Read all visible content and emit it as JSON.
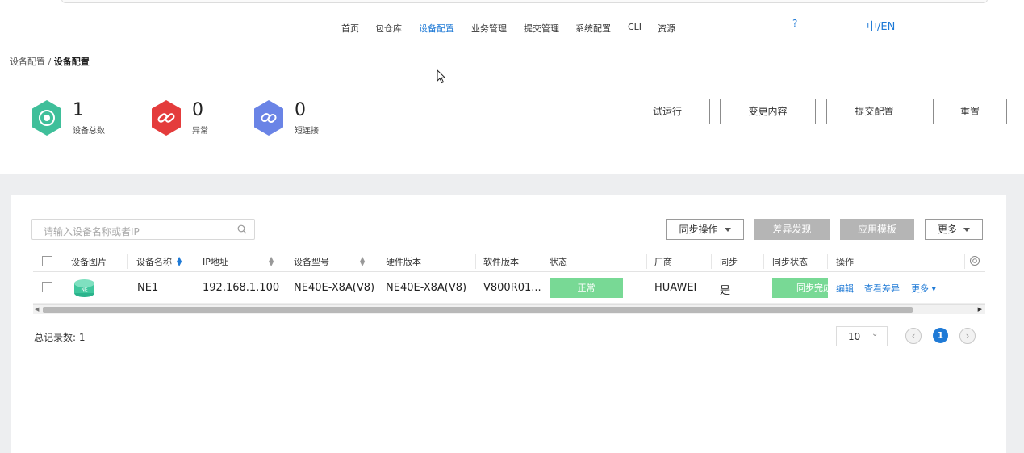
{
  "nav": {
    "items": [
      "首页",
      "包仓库",
      "设备配置",
      "业务管理",
      "提交管理",
      "系统配置",
      "CLI",
      "资源"
    ],
    "active_index": 2,
    "help": "?",
    "lang": "中/EN"
  },
  "breadcrumb": {
    "parent": "设备配置 / ",
    "current": "设备配置"
  },
  "stats": [
    {
      "value": "1",
      "label": "设备总数",
      "color": "#3fbf9a",
      "icon": "device-icon"
    },
    {
      "value": "0",
      "label": "异常",
      "color": "#e43c3c",
      "icon": "broken-link-icon"
    },
    {
      "value": "0",
      "label": "短连接",
      "color": "#6a84e6",
      "icon": "link-icon"
    }
  ],
  "actions": {
    "trial_run": "试运行",
    "change_content": "变更内容",
    "submit_config": "提交配置",
    "reset": "重置"
  },
  "toolbar": {
    "search_placeholder": "请输入设备名称或者IP",
    "sync_ops": "同步操作",
    "diff_discovery": "差异发现",
    "apply_template": "应用模板",
    "more": "更多"
  },
  "table": {
    "headers": [
      "设备图片",
      "设备名称",
      "IP地址",
      "设备型号",
      "硬件版本",
      "软件版本",
      "状态",
      "厂商",
      "同步",
      "同步状态",
      "操作"
    ],
    "rows": [
      {
        "name": "NE1",
        "ip": "192.168.1.100",
        "model": "NE40E-X8A(V8)",
        "hardware": "NE40E-X8A(V8)",
        "software": "V800R01...",
        "status": "正常",
        "vendor": "HUAWEI",
        "sync": "是",
        "sync_status": "同步完成",
        "op_edit": "编辑",
        "op_diff": "查看差异",
        "op_more": "更多 ▾"
      }
    ]
  },
  "footer": {
    "total": "总记录数: 1",
    "page_size": "10",
    "current_page": "1"
  },
  "colors": {
    "accent": "#1f7ad6",
    "status_ok": "#78d995",
    "disabled": "#b5b5b5"
  }
}
